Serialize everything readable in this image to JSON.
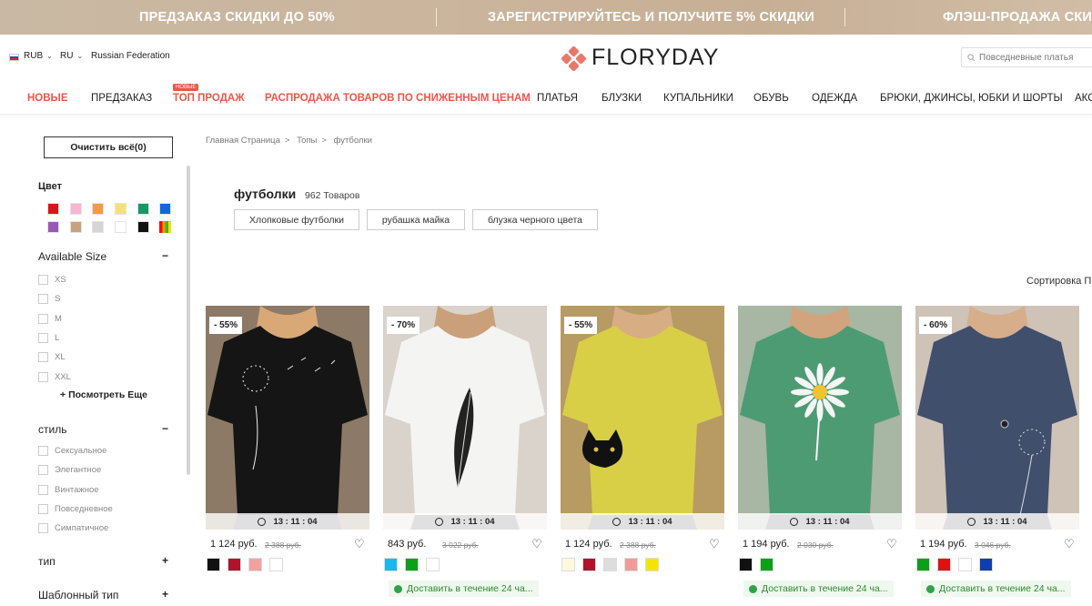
{
  "promo": {
    "items": [
      "ПРЕДЗАКАЗ СКИДКИ ДО 50%",
      "ЗАРЕГИСТРИРУЙТЕСЬ И ПОЛУЧИТЕ 5% СКИДКИ",
      "ФЛЭШ-ПРОДАЖА СКИД"
    ]
  },
  "topbar": {
    "currency": "RUB",
    "language": "RU",
    "country": "Russian Federation",
    "logo": "FLORYDAY",
    "search_placeholder": "Повседневные платья"
  },
  "nav": {
    "new_tag": "НОВЫЕ",
    "items": [
      "НОВЫЕ",
      "ПРЕДЗАКАЗ",
      "ТОП ПРОДАЖ",
      "РАСПРОДАЖА ТОВАРОВ ПО СНИЖЕННЫМ ЦЕНАМ",
      "ПЛАТЬЯ",
      "БЛУЗКИ",
      "КУПАЛЬНИКИ",
      "ОБУВЬ",
      "ОДЕЖДА",
      "БРЮКИ, ДЖИНСЫ, ЮБКИ И ШОРТЫ",
      "АКС"
    ]
  },
  "sidebar": {
    "clear_label": "Очистить всё(0)",
    "color_title": "Цвет",
    "colors": [
      "#d9141b",
      "#f8b6d2",
      "#f59a46",
      "#f6e07d",
      "#159a63",
      "#1467d8",
      "#9b59b6",
      "#c8a27a",
      "#d5d5d5",
      "#ffffff",
      "#111111",
      "multicolor"
    ],
    "size_title": "Available Size",
    "sizes": [
      "XS",
      "S",
      "M",
      "L",
      "XL",
      "XXL"
    ],
    "see_more": "Посмотреть Еще",
    "style_title": "стиль",
    "styles": [
      "Сексуальное",
      "Элегантное",
      "Винтажное",
      "Повседневное",
      "Симпатичное"
    ],
    "type_title": "тип",
    "pattern_title": "Шаблонный тип",
    "minus": "−",
    "plus": "+"
  },
  "breadcrumb": [
    "Главная Страница",
    "Топы",
    "футболки"
  ],
  "breadcrumb_sep": ">",
  "listing": {
    "title": "футболки",
    "count": "962 Товаров",
    "tags": [
      "Хлопковые футболки",
      "рубашка майка",
      "блузка черного цвета"
    ],
    "sort_label": "Сортировка По"
  },
  "products": [
    {
      "discount": "- 55%",
      "timer": "13 : 11 : 04",
      "price": "1 124 руб.",
      "old_price": "2 388 руб.",
      "colors": [
        "#111111",
        "#b0132b",
        "#f2a0a0",
        "#ffffff"
      ],
      "ship": null
    },
    {
      "discount": "- 70%",
      "timer": "13 : 11 : 04",
      "price": "843 руб.",
      "old_price": "3 022 руб.",
      "colors": [
        "#18b9ee",
        "#0aa018",
        "#ffffff"
      ],
      "ship": "Доставить в течение 24 ча..."
    },
    {
      "discount": "- 55%",
      "timer": "13 : 11 : 04",
      "price": "1 124 руб.",
      "old_price": "2 388 руб.",
      "colors": [
        "#fff8e0",
        "#b0132b",
        "#dddddd",
        "#f29a9a",
        "#f2e600"
      ],
      "ship": null
    },
    {
      "discount": "",
      "timer": "13 : 11 : 04",
      "price": "1 194 руб.",
      "old_price": "2 030 руб.",
      "colors": [
        "#111111",
        "#0aa018"
      ],
      "ship": "Доставить в течение 24 ча..."
    },
    {
      "discount": "- 60%",
      "timer": "13 : 11 : 04",
      "price": "1 194 руб.",
      "old_price": "3 046 руб.",
      "colors": [
        "#0aa018",
        "#e01010",
        "#ffffff",
        "#0d3fb0"
      ],
      "ship": "Доставить в течение 24 ча..."
    }
  ]
}
